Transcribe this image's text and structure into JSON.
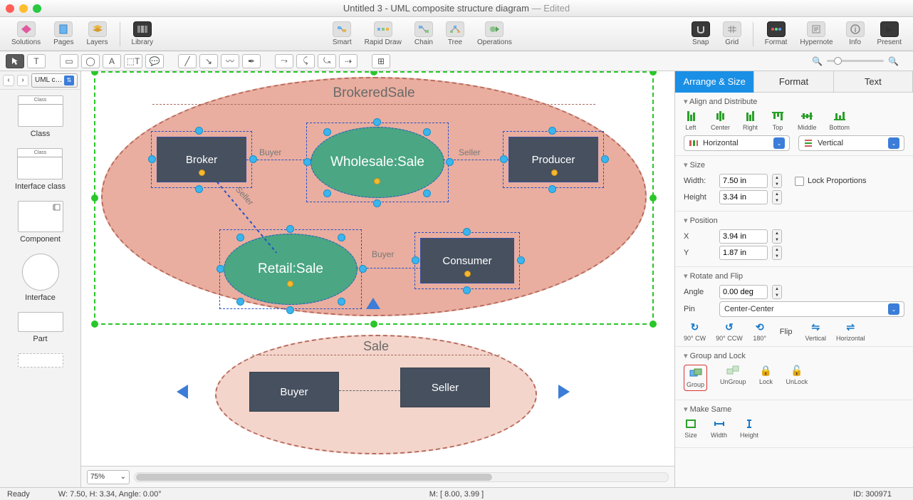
{
  "window": {
    "title": "Untitled 3 - UML composite structure diagram",
    "edited": " — Edited"
  },
  "toolbar1": {
    "solutions": "Solutions",
    "pages": "Pages",
    "layers": "Layers",
    "library": "Library",
    "smart": "Smart",
    "rapiddraw": "Rapid Draw",
    "chain": "Chain",
    "tree": "Tree",
    "operations": "Operations",
    "snap": "Snap",
    "grid": "Grid",
    "format": "Format",
    "hypernote": "Hypernote",
    "info": "Info",
    "present": "Present"
  },
  "leftnav": {
    "selector": "UML c…"
  },
  "shapes": {
    "class": "Class",
    "class_header": "Class",
    "interface_class": "Interface class",
    "interface_class_header": "Class",
    "component": "Component",
    "interface": "Interface",
    "part": "Part"
  },
  "diagram": {
    "brokered_title": "BrokeredSale",
    "broker": "Broker",
    "producer": "Producer",
    "consumer": "Consumer",
    "wholesale": "Wholesale:Sale",
    "retail": "Retail:Sale",
    "buyer_lbl1": "Buyer",
    "seller_lbl1": "Seller",
    "seller_lbl2": "Seller",
    "buyer_lbl2": "Buyer",
    "sale_title": "Sale",
    "buyer": "Buyer",
    "seller": "Seller"
  },
  "inspector": {
    "tabs": {
      "arrange": "Arrange & Size",
      "format": "Format",
      "text": "Text"
    },
    "align": {
      "title": "Align and Distribute",
      "left": "Left",
      "center": "Center",
      "right": "Right",
      "top": "Top",
      "middle": "Middle",
      "bottom": "Bottom",
      "horizontal": "Horizontal",
      "vertical": "Vertical"
    },
    "size": {
      "title": "Size",
      "width_k": "Width:",
      "width_v": "7.50 in",
      "height_k": "Height",
      "height_v": "3.34 in",
      "lock": "Lock Proportions"
    },
    "position": {
      "title": "Position",
      "x_k": "X",
      "x_v": "3.94 in",
      "y_k": "Y",
      "y_v": "1.87 in"
    },
    "rotate": {
      "title": "Rotate and Flip",
      "angle_k": "Angle",
      "angle_v": "0.00 deg",
      "pin_k": "Pin",
      "pin_v": "Center-Center",
      "cw": "90° CW",
      "ccw": "90° CCW",
      "d180": "180°",
      "flip": "Flip",
      "vert": "Vertical",
      "horiz": "Horizontal"
    },
    "group": {
      "title": "Group and Lock",
      "group": "Group",
      "ungroup": "UnGroup",
      "lock": "Lock",
      "unlock": "UnLock"
    },
    "same": {
      "title": "Make Same",
      "size": "Size",
      "width": "Width",
      "height": "Height"
    }
  },
  "canvas_footer": {
    "zoom": "75%"
  },
  "status": {
    "ready": "Ready",
    "dims": "W: 7.50,  H: 3.34,  Angle: 0.00°",
    "mouse": "M: [ 8.00, 3.99 ]",
    "id": "ID: 300971"
  }
}
